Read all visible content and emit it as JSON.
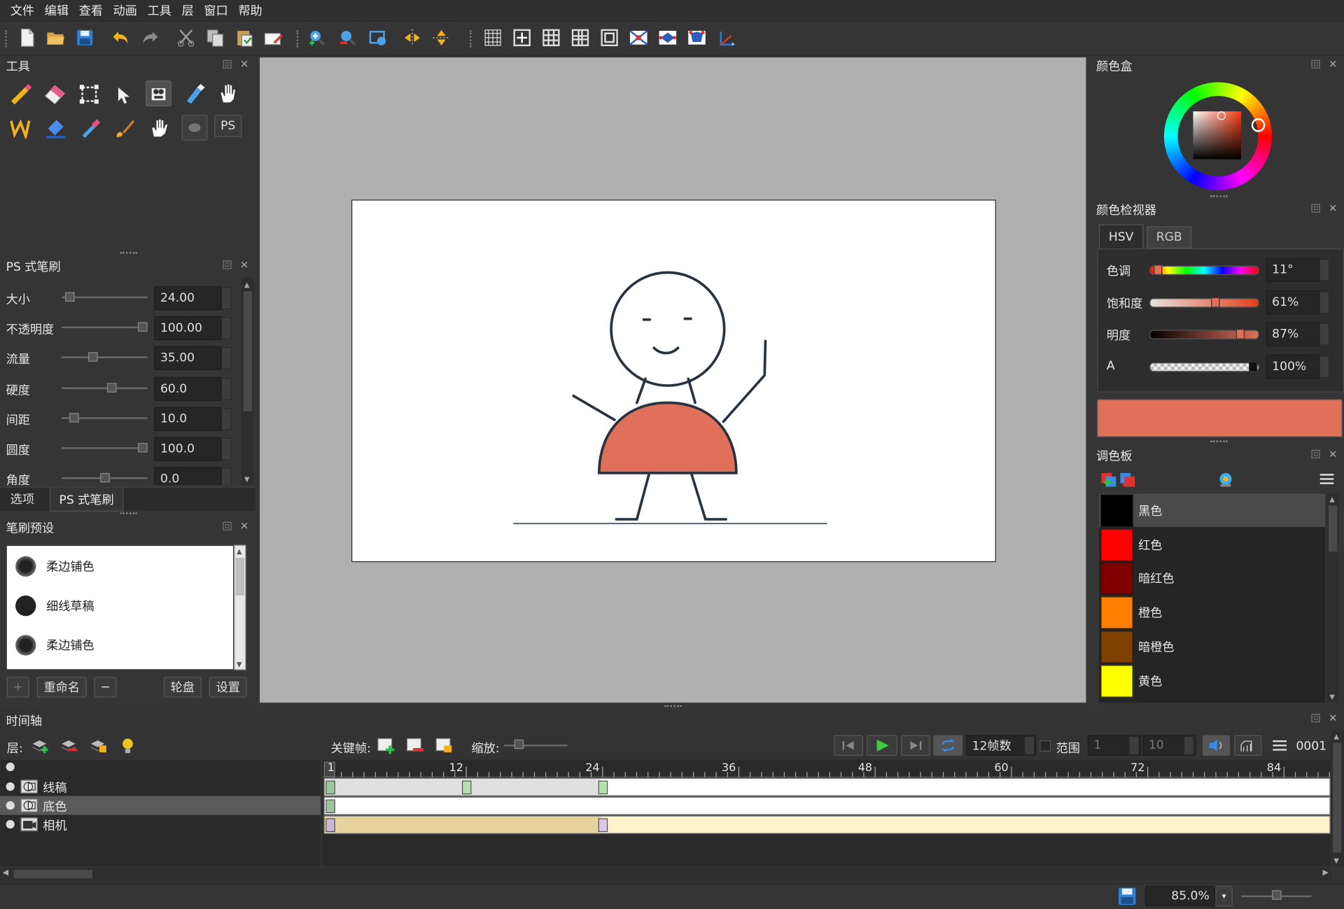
{
  "menu": [
    "文件",
    "编辑",
    "查看",
    "动画",
    "工具",
    "层",
    "窗口",
    "帮助"
  ],
  "panels": {
    "tools": {
      "title": "工具",
      "ps_label": "PS"
    },
    "brush": {
      "title": "PS 式笔刷",
      "params": [
        {
          "label": "大小",
          "value": "24.00",
          "level": 0.05
        },
        {
          "label": "不透明度",
          "value": "100.00",
          "level": 1.0
        },
        {
          "label": "流量",
          "value": "35.00",
          "level": 0.35
        },
        {
          "label": "硬度",
          "value": "60.0",
          "level": 0.6
        },
        {
          "label": "间距",
          "value": "10.0",
          "level": 0.1
        },
        {
          "label": "圆度",
          "value": "100.0",
          "level": 1.0
        },
        {
          "label": "角度",
          "value": "0.0",
          "level": 0.5
        }
      ],
      "tabs": [
        "选项",
        "PS 式笔刷"
      ]
    },
    "presets": {
      "title": "笔刷预设",
      "items": [
        "柔边铺色",
        "细线草稿",
        "柔边铺色"
      ],
      "buttons": {
        "add": "+",
        "rename": "重命名",
        "remove": "−",
        "wheel": "轮盘",
        "settings": "设置"
      }
    },
    "colorbox": {
      "title": "颜色盒"
    },
    "inspector": {
      "title": "颜色检视器",
      "tabs": [
        "HSV",
        "RGB"
      ],
      "rows": [
        {
          "label": "色调",
          "value": "11°",
          "level": 0.03
        },
        {
          "label": "饱和度",
          "value": "61%",
          "level": 0.61
        },
        {
          "label": "明度",
          "value": "87%",
          "level": 0.87
        },
        {
          "label": "A",
          "value": "100%",
          "level": 1.0
        }
      ],
      "current_color": "#e0705a"
    },
    "palette": {
      "title": "调色板",
      "swatches": [
        {
          "name": "黑色",
          "color": "#000000"
        },
        {
          "name": "红色",
          "color": "#ff0000"
        },
        {
          "name": "暗红色",
          "color": "#800000"
        },
        {
          "name": "橙色",
          "color": "#ff8000"
        },
        {
          "name": "暗橙色",
          "color": "#804000"
        },
        {
          "name": "黄色",
          "color": "#ffff00"
        }
      ]
    }
  },
  "timeline": {
    "title": "时间轴",
    "layers_label": "层:",
    "keyframe_label": "关键帧:",
    "zoom_label": "缩放:",
    "fps": "12帧数",
    "range_label": "范围",
    "range_start": "1",
    "range_end": "10",
    "frame_counter": "0001",
    "ruler": [
      "1",
      "12",
      "24",
      "36",
      "48",
      "60",
      "72",
      "84"
    ],
    "layers": [
      {
        "name": "线稿",
        "type": "vector"
      },
      {
        "name": "底色",
        "type": "vector"
      },
      {
        "name": "相机",
        "type": "camera"
      }
    ]
  },
  "status": {
    "zoom": "85.0%"
  }
}
